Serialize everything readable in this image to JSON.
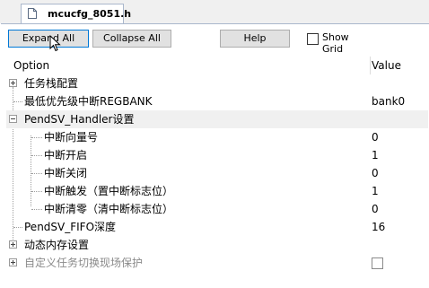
{
  "tab": {
    "title": "mcucfg_8051.h"
  },
  "toolbar": {
    "expand_all": "Expand All",
    "collapse_all": "Collapse All",
    "help": "Help",
    "show_grid": "Show Grid"
  },
  "grid": {
    "col_option": "Option",
    "col_value": "Value",
    "rows": [
      {
        "label": "任务栈配置",
        "value": ""
      },
      {
        "label": "最低优先级中断REGBANK",
        "value": "bank0"
      },
      {
        "label": "PendSV_Handler设置",
        "value": ""
      },
      {
        "label": "中断向量号",
        "value": "0"
      },
      {
        "label": "中断开启",
        "value": "1"
      },
      {
        "label": "中断关闭",
        "value": "0"
      },
      {
        "label": "中断触发（置中断标志位）",
        "value": "1"
      },
      {
        "label": "中断清零（清中断标志位）",
        "value": "0"
      },
      {
        "label": "PendSV_FIFO深度",
        "value": "16"
      },
      {
        "label": "动态内存设置",
        "value": ""
      },
      {
        "label": "自定义任务切换现场保护",
        "value": ""
      }
    ]
  }
}
